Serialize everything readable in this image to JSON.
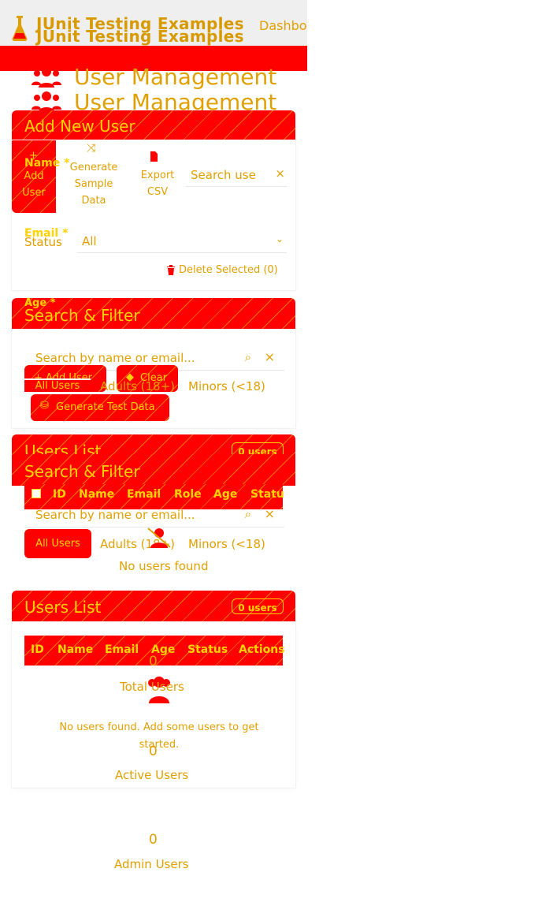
{
  "app": {
    "brand_line_1": "JUnit Testing Examples",
    "brand_line_2": "JUnit Testing Examples",
    "nav_dashboard": "Dashbo"
  },
  "page": {
    "title_1": "User Management",
    "title_2": "User Management"
  },
  "add_user": {
    "title": "Add New User",
    "name_label": "Name *",
    "email_label": "Email *",
    "age_label": "Age *",
    "buttons": {
      "add_user_lines": [
        "Add",
        "User"
      ],
      "generate_lines": [
        "Generate",
        "Sample",
        "Data"
      ],
      "export_lines": [
        "Export",
        "CSV"
      ],
      "add_user_inline": "+ Add User",
      "clear_inline": "Clear",
      "generate_test_data": "Generate Test Data"
    },
    "search_placeholder": "Search use",
    "status_label": "Status",
    "status_value": "All",
    "delete_selected": "Delete Selected (0)"
  },
  "search_filter": {
    "title": "Search & Filter",
    "placeholder": "Search by name or email...",
    "filters": [
      "All Users",
      "Adults (18+)",
      "Minors (<18)"
    ],
    "no_users": "No users found"
  },
  "users_list": {
    "title": "Users List",
    "count_badge": "0 users",
    "columns_1": [
      "ID",
      "Name",
      "Email",
      "Role",
      "Age",
      "Statu"
    ],
    "columns_2": [
      "ID",
      "Name",
      "Email",
      "Age",
      "Status",
      "Actions"
    ],
    "empty_message": "No users found. Add some users to get started."
  },
  "stats": {
    "total_value": "0",
    "total_label": "Total Users",
    "active_value": "0",
    "active_label": "Active Users",
    "admin_value": "0",
    "admin_label": "Admin Users"
  },
  "colors": {
    "primary": "#ff0000",
    "accent_text": "#ffd200",
    "body_text": "#e0a000"
  },
  "icons": [
    "flask-icon",
    "users-icon",
    "shuffle-icon",
    "file-csv-icon",
    "trash-icon",
    "search-icon",
    "close-icon",
    "chevron-down-icon",
    "user-slash-icon",
    "plus-icon",
    "eraser-icon",
    "database-icon"
  ]
}
